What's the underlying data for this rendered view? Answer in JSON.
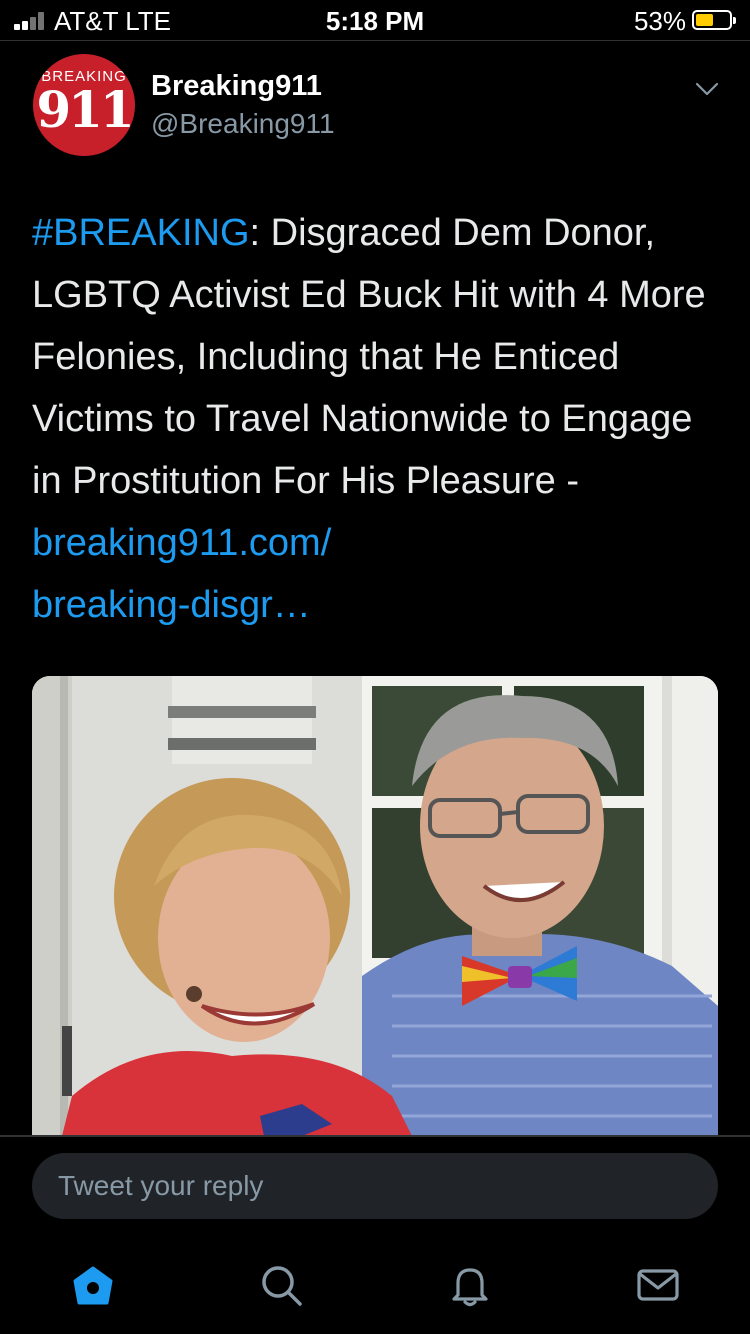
{
  "status_bar": {
    "carrier": "AT&T  LTE",
    "time": "5:18 PM",
    "battery_percent": "53%",
    "battery_level": 0.53
  },
  "tweet": {
    "avatar": {
      "logo_top": "BREAKING",
      "logo_number": "911",
      "brand_color": "#c8202b"
    },
    "display_name": "Breaking911",
    "handle": "@Breaking911",
    "hashtag": "#BREAKING",
    "body": ": Disgraced Dem Donor, LGBTQ Activist Ed Buck Hit with 4 More Felonies, Including that He Enticed Victims to Travel Nationwide to Engage in Prostitution For His Pleasure - ",
    "link_line1": "breaking911.com/",
    "link_line2": "breaking-disgr…",
    "link_color": "#1d9bf0",
    "media_icon": "photo-of-two-people-icon"
  },
  "reply": {
    "placeholder": "Tweet your reply"
  },
  "tab_bar": {
    "tabs": [
      {
        "icon": "home-icon",
        "active": true
      },
      {
        "icon": "search-icon",
        "active": false
      },
      {
        "icon": "bell-icon",
        "active": false
      },
      {
        "icon": "mail-icon",
        "active": false
      }
    ],
    "active_color": "#1d9bf0",
    "inactive_color": "#8899a6"
  }
}
